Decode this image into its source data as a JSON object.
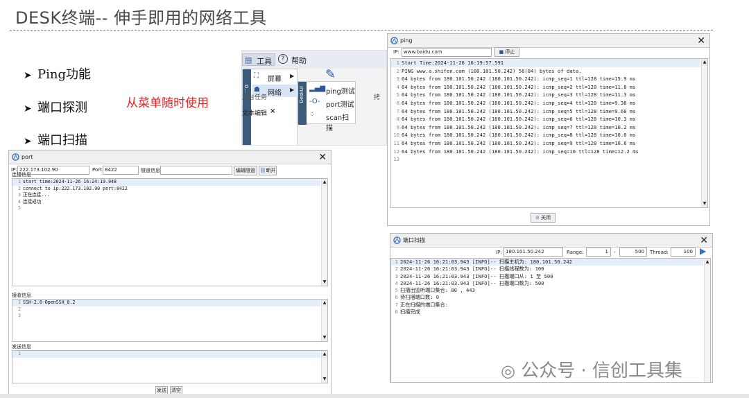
{
  "slide": {
    "title": "DESK终端-- 伸手即用的网络工具",
    "bullets": [
      "Ping功能",
      "端口探测",
      "端口扫描"
    ],
    "red_note": "从菜单随时使用",
    "watermark": "公众号 · 信创工具集"
  },
  "menu": {
    "tools": "工具",
    "help": "帮助",
    "screen": "屏幕",
    "network": "网络",
    "sub": [
      "ping测试",
      "port测试",
      "scan扫描"
    ],
    "behind_text1": "后台任务",
    "behind_text2": "文本编辑",
    "behind_text3": "拷",
    "side_label": "DeskUI",
    "side_label2": "D..."
  },
  "ping": {
    "title": "ping",
    "ip_label": "IP:",
    "ip_value": "www.baidu.com",
    "stop": "停止",
    "close": "关闭",
    "lines": [
      "Start Time:2024-11-26 16:19:57.591",
      "PING www.a.shifen.com (180.101.50.242) 56(84) bytes of data.",
      "64 bytes from 180.101.50.242 (180.101.50.242): icmp_seq=1 ttl=128 time=15.9 ms",
      "64 bytes from 180.101.50.242 (180.101.50.242): icmp_seq=2 ttl=128 time=11.8 ms",
      "64 bytes from 180.101.50.242 (180.101.50.242): icmp_seq=3 ttl=128 time=11.3 ms",
      "64 bytes from 180.101.50.242 (180.101.50.242): icmp_seq=4 ttl=128 time=9.38 ms",
      "64 bytes from 180.101.50.242 (180.101.50.242): icmp_seq=5 ttl=128 time=9.60 ms",
      "64 bytes from 180.101.50.242 (180.101.50.242): icmp_seq=6 ttl=128 time=10.3 ms",
      "64 bytes from 180.101.50.242 (180.101.50.242): icmp_seq=7 ttl=128 time=10.2 ms",
      "64 bytes from 180.101.50.242 (180.101.50.242): icmp_seq=8 ttl=128 time=10.0 ms",
      "64 bytes from 180.101.50.242 (180.101.50.242): icmp_seq=9 ttl=128 time=10.6 ms",
      "64 bytes from 180.101.50.242 (180.101.50.242): icmp_seq=10 ttl=128 time=12.2 ms",
      ""
    ]
  },
  "port": {
    "title": "port",
    "ip_label": "IP:",
    "ip_value": "222.173.102.90",
    "port_label": "Port:",
    "port_value": "8422",
    "tunnel_label": "隧道信息:",
    "tunnel_value": "",
    "edit_tunnel": "编辑隧道",
    "disconnect": "断开",
    "conn_info": "连接信息",
    "conn_lines": [
      "start time:2024-11-26 16:24:19.948",
      "connect to ip:222.173.102.90 port:8422",
      "正在连接...",
      "连接成功",
      ""
    ],
    "recv_info": "接收信息",
    "recv_lines": [
      "SSH-2.0-OpenSSH_8.2",
      "",
      ""
    ],
    "send_info": "发送信息",
    "send_lines": [
      ""
    ],
    "send": "发送",
    "clear": "清空"
  },
  "scan": {
    "title": "端口扫描",
    "ip_label": "IP:",
    "ip_value": "180.101.50.242",
    "range_label": "Range:",
    "range_from": "1",
    "range_to": "500",
    "thread_label": "Thread:",
    "thread_value": "100",
    "lines": [
      "2024-11-26 16:21:03.943 [INFO]-- 扫描主机为: 180.101.50.242",
      "2024-11-26 16:21:03.943 [INFO]-- 扫描线程数为: 100",
      "2024-11-26 16:21:03.943 [INFO]-- 扫描端口从: 1 至 500",
      "2024-11-26 16:21:03.943 [INFO]-- 扫描端口数为: 500",
      "扫描出监听端口集合: 80 , 443",
      "待扫描端口数: 0",
      "正在扫描的端口集合:",
      "扫描完成"
    ]
  }
}
